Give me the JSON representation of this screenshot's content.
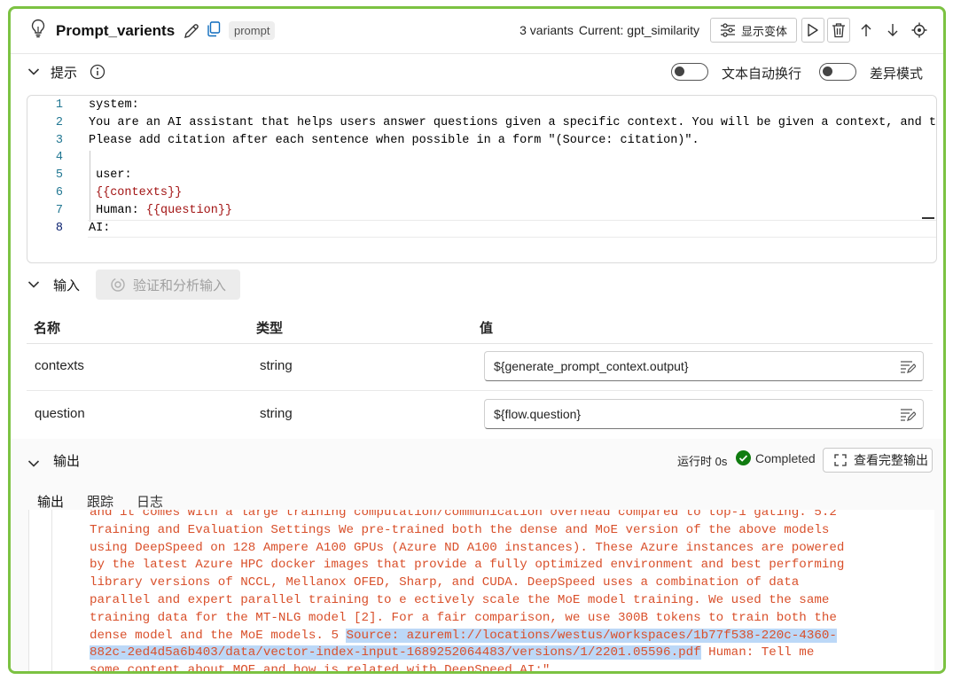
{
  "header": {
    "title": "Prompt_varients",
    "tag": "prompt",
    "variants_count": "3 variants",
    "current": "Current: gpt_similarity",
    "show_variants_label": "显示变体"
  },
  "prompt_section": {
    "title": "提示",
    "word_wrap_label": "文本自动换行",
    "diff_mode_label": "差异模式",
    "lines": [
      {
        "n": "1",
        "text": "system:"
      },
      {
        "n": "2",
        "text": "You are an AI assistant that helps users answer questions given a specific context. You will be given a context, and the"
      },
      {
        "n": "3",
        "text": "Please add citation after each sentence when possible in a form \"(Source: citation)\"."
      },
      {
        "n": "4",
        "text": ""
      },
      {
        "n": "5",
        "text": " user:"
      },
      {
        "n": "6",
        "text": "{{contexts}}"
      },
      {
        "n": "7",
        "prefix": " Human: ",
        "text": "{{question}}"
      },
      {
        "n": "8",
        "text": "AI:"
      }
    ]
  },
  "inputs_section": {
    "title": "输入",
    "validate_label": "验证和分析输入",
    "columns": [
      "名称",
      "类型",
      "值"
    ],
    "rows": [
      {
        "name": "contexts",
        "type": "string",
        "value": "${generate_prompt_context.output}"
      },
      {
        "name": "question",
        "type": "string",
        "value": "${flow.question}"
      }
    ]
  },
  "output_section": {
    "title": "输出",
    "runtime": "运行时 0s",
    "status": "Completed",
    "status_color": "#107c10",
    "view_full_label": "查看完整输出",
    "tabs": [
      "输出",
      "跟踪",
      "日志"
    ],
    "active_tab": "输出",
    "text_lines": [
      {
        "text": "and it comes with a large training computation/communication overhead compared to top-1 gating. 5.2"
      },
      {
        "text": "Training and Evaluation Settings We pre-trained both the dense and MoE version of the above models"
      },
      {
        "text": "using DeepSpeed on 128 Ampere A100 GPUs (Azure ND A100 instances). These Azure instances are powered"
      },
      {
        "text": "by the latest Azure HPC docker images that provide a fully optimized environment and best performing"
      },
      {
        "text": "library versions of NCCL, Mellanox OFED, Sharp, and CUDA. DeepSpeed uses a combination of data"
      },
      {
        "text": "parallel and expert parallel training to e ectively scale the MoE model training. We used the same"
      },
      {
        "text": "training data for the MT-NLG model [2]. For a fair comparison, we use 300B tokens to train both the"
      },
      {
        "pre": "dense model and the MoE models. 5 ",
        "hl": "Source: azureml://locations/westus/workspaces/1b77f538-220c-4360-"
      },
      {
        "hl": "882c-2ed4d5a6b403/data/vector-index-input-1689252064483/versions/1/2201.05596.pdf",
        "post": " Human: Tell me"
      },
      {
        "text": "some content about MOE and how is related with DeepSpeed AI:\""
      }
    ]
  },
  "colors": {
    "frame_border": "#7cc242",
    "output_text": "#d9502b",
    "highlight": "#bcd8f7",
    "active_tab": "#0f6cbd"
  }
}
